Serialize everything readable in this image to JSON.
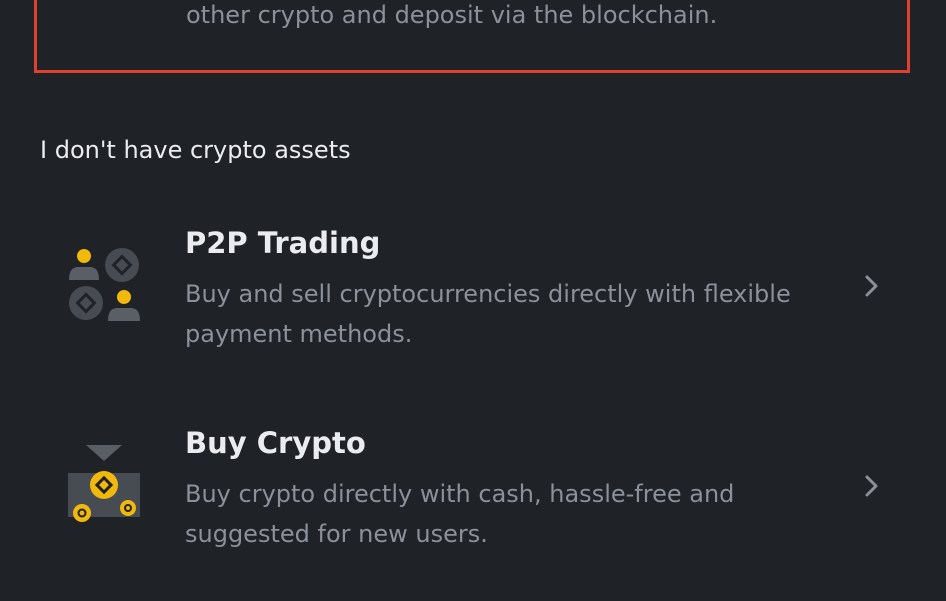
{
  "top_card": {
    "description_tail": "other crypto and deposit via the blockchain."
  },
  "no_assets_section": {
    "heading": "I don't have crypto assets",
    "options": [
      {
        "title": "P2P Trading",
        "description": "Buy and sell cryptocurrencies directly with flexible payment methods.",
        "icon": "p2p-trading-icon"
      },
      {
        "title": "Buy Crypto",
        "description": "Buy crypto directly with cash, hassle-free and suggested for new users.",
        "icon": "buy-crypto-icon"
      }
    ]
  },
  "colors": {
    "background": "#1f2227",
    "highlight_border": "#e0412f",
    "accent_yellow": "#f0b90b",
    "text_primary": "#eaecef",
    "text_secondary": "#8b9099"
  }
}
